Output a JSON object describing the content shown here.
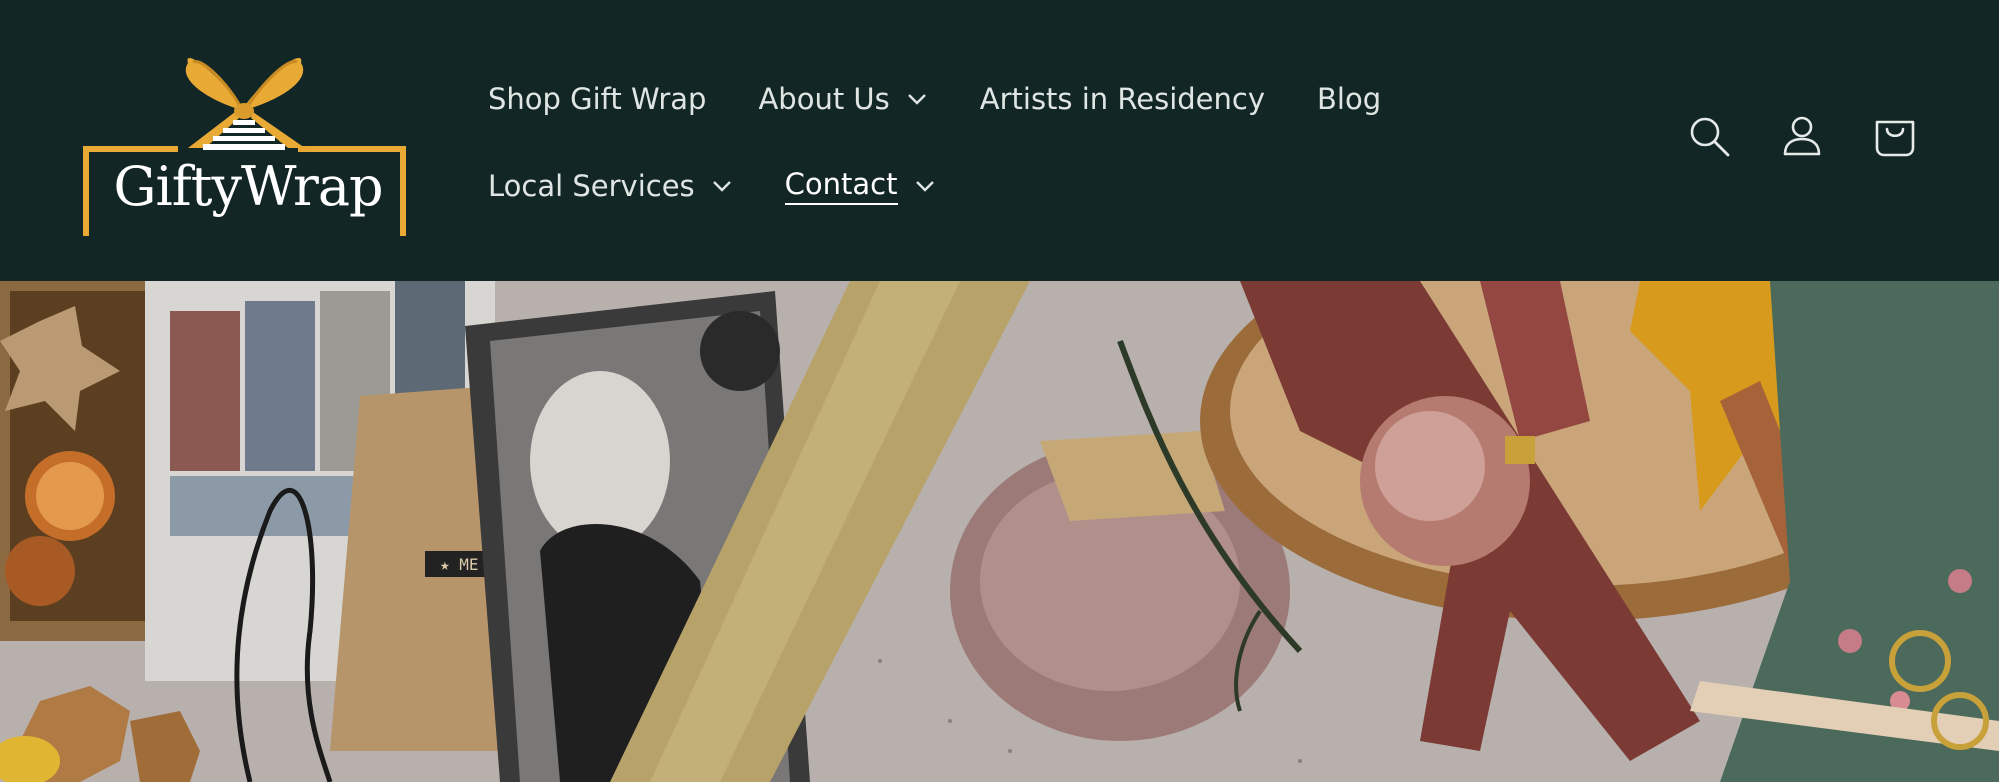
{
  "brand": {
    "name": "GiftyWrap",
    "gold": "#e8a935",
    "background": "#132626"
  },
  "nav": {
    "row1": [
      {
        "label": "Shop Gift Wrap",
        "dropdown": false
      },
      {
        "label": "About Us",
        "dropdown": true
      },
      {
        "label": "Artists in Residency",
        "dropdown": false
      },
      {
        "label": "Blog",
        "dropdown": false
      }
    ],
    "row2": [
      {
        "label": "Local Services",
        "dropdown": true
      },
      {
        "label": "Contact",
        "dropdown": true,
        "active": true
      }
    ]
  },
  "header_icons": [
    "search-icon",
    "account-icon",
    "cart-icon"
  ],
  "hero": {
    "icon": "gift-wrapping-flatlay-photo"
  }
}
